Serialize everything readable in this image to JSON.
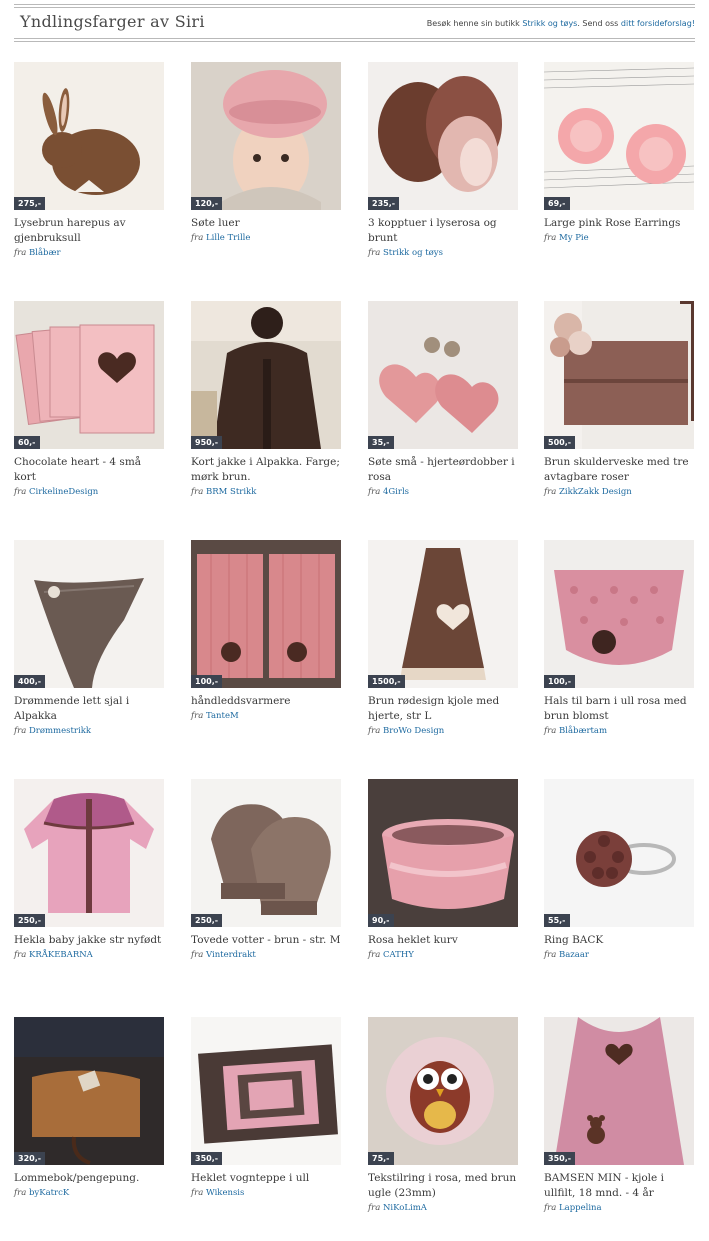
{
  "header": {
    "title": "Yndlingsfarger av Siri",
    "promo_text": "Besøk henne sin butikk ",
    "promo_shop": "Strikk og tøys",
    "promo_mid": ". Send oss ",
    "promo_link": "ditt forsideforslag!"
  },
  "from_label": "fra",
  "products": [
    {
      "price": "275,-",
      "title": "Lysebrun harepus av gjenbruksull",
      "shop": "Blåbær",
      "icon": "brown-bunny"
    },
    {
      "price": "120,-",
      "title": "Søte luer",
      "shop": "Lille Trille",
      "icon": "pink-beret-child"
    },
    {
      "price": "235,-",
      "title": "3 kopptuer i lyserosa og brunt",
      "shop": "Strikk og tøys",
      "icon": "knitted-cowls"
    },
    {
      "price": "69,-",
      "title": "Large pink Rose Earrings",
      "shop": "My Pie",
      "icon": "rose-earrings"
    },
    {
      "price": "60,-",
      "title": "Chocolate heart - 4 små kort",
      "shop": "CirkelineDesign",
      "icon": "heart-cards"
    },
    {
      "price": "950,-",
      "title": "Kort jakke i Alpakka. Farge; mørk brun.",
      "shop": "BRM Strikk",
      "icon": "brown-cardigan"
    },
    {
      "price": "35,-",
      "title": "Søte små - hjerteørdobber i rosa",
      "shop": "4Girls",
      "icon": "heart-earrings"
    },
    {
      "price": "500,-",
      "title": "Brun skulderveske med tre avtagbare roser",
      "shop": "ZikkZakk Design",
      "icon": "shoulder-bag"
    },
    {
      "price": "400,-",
      "title": "Drømmende lett sjal i Alpakka",
      "shop": "Drømmestrikk",
      "icon": "alpaca-shawl"
    },
    {
      "price": "100,-",
      "title": "håndleddsvarmere",
      "shop": "TanteM",
      "icon": "wrist-warmers"
    },
    {
      "price": "1500,-",
      "title": "Brun rødesign kjole med hjerte, str L",
      "shop": "BroWo Design",
      "icon": "brown-dress"
    },
    {
      "price": "100,-",
      "title": "Hals til barn i ull rosa med brun blomst",
      "shop": "Blåbærtam",
      "icon": "pink-neckwarmer"
    },
    {
      "price": "250,-",
      "title": "Hekla baby jakke str nyfødt",
      "shop": "KRÅKEBARNA",
      "icon": "baby-jacket"
    },
    {
      "price": "250,-",
      "title": "Tovede votter - brun - str. M",
      "shop": "Vinterdrakt",
      "icon": "felted-mittens"
    },
    {
      "price": "90,-",
      "title": "Rosa heklet kurv",
      "shop": "CATHY",
      "icon": "crochet-basket"
    },
    {
      "price": "55,-",
      "title": "Ring BACK",
      "shop": "Bazaar",
      "icon": "flower-ring"
    },
    {
      "price": "320,-",
      "title": "Lommebok/pengepung.",
      "shop": "byKatrcK",
      "icon": "leather-purse"
    },
    {
      "price": "350,-",
      "title": "Heklet vognteppe i ull",
      "shop": "Wikensis",
      "icon": "crochet-blanket"
    },
    {
      "price": "75,-",
      "title": "Tekstilring i rosa, med brun ugle (23mm)",
      "shop": "NiKoLimA",
      "icon": "owl-ring"
    },
    {
      "price": "350,-",
      "title": "BAMSEN MIN - kjole i ullfilt, 18 mnd. - 4 år",
      "shop": "Lappelina",
      "icon": "teddy-dress"
    }
  ]
}
